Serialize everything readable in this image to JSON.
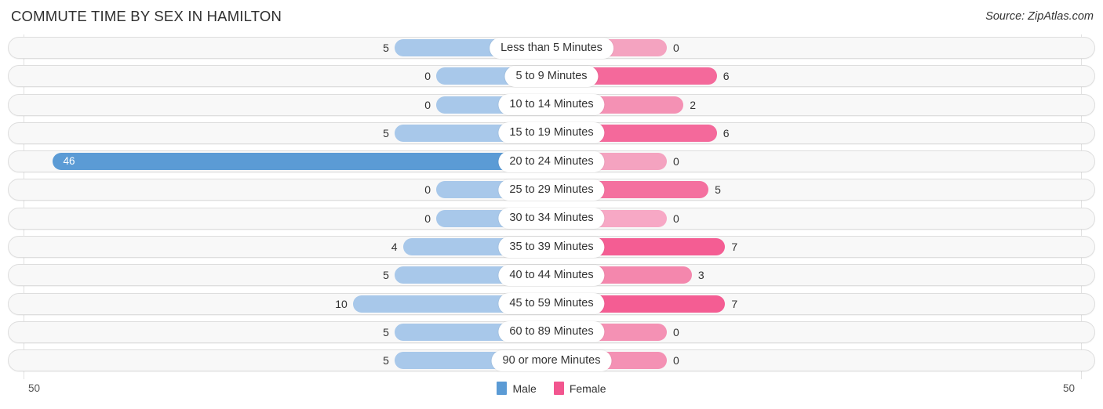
{
  "header": {
    "title": "COMMUTE TIME BY SEX IN HAMILTON",
    "source": "Source: ZipAtlas.com"
  },
  "axis": {
    "left_label": "50",
    "right_label": "50"
  },
  "legend": {
    "items": [
      {
        "label": "Male",
        "color": "#5b9bd5"
      },
      {
        "label": "Female",
        "color": "#f2568f"
      }
    ]
  },
  "chart_data": {
    "type": "bar",
    "title": "COMMUTE TIME BY SEX IN HAMILTON",
    "subtitle": "Source: ZipAtlas.com",
    "orientation": "horizontal-diverging",
    "xlabel": "",
    "ylabel": "",
    "xlim": [
      -50,
      50
    ],
    "axis_max": 50,
    "grid": true,
    "legend_position": "bottom-center",
    "categories": [
      "Less than 5 Minutes",
      "5 to 9 Minutes",
      "10 to 14 Minutes",
      "15 to 19 Minutes",
      "20 to 24 Minutes",
      "25 to 29 Minutes",
      "30 to 34 Minutes",
      "35 to 39 Minutes",
      "40 to 44 Minutes",
      "45 to 59 Minutes",
      "60 to 89 Minutes",
      "90 or more Minutes"
    ],
    "series": [
      {
        "name": "Male",
        "color": "#5b9bd5",
        "values": [
          5,
          0,
          0,
          5,
          46,
          0,
          0,
          4,
          5,
          10,
          5,
          5
        ]
      },
      {
        "name": "Female",
        "color": "#f2568f",
        "values": [
          0,
          6,
          2,
          6,
          0,
          5,
          0,
          7,
          3,
          7,
          0,
          0
        ]
      }
    ],
    "rows": [
      {
        "label": "Less than 5 Minutes",
        "male": 5,
        "male_text": "5",
        "female": 0,
        "female_text": "0",
        "male_color": "#a8c8ea",
        "female_color": "#f4a3c0",
        "male_highlight": false,
        "male_label_inside": false
      },
      {
        "label": "5 to 9 Minutes",
        "male": 0,
        "male_text": "0",
        "female": 6,
        "female_text": "6",
        "male_color": "#a8c8ea",
        "female_color": "#f4699b",
        "male_highlight": false,
        "male_label_inside": false
      },
      {
        "label": "10 to 14 Minutes",
        "male": 0,
        "male_text": "0",
        "female": 2,
        "female_text": "2",
        "male_color": "#a8c8ea",
        "female_color": "#f491b4",
        "male_highlight": false,
        "male_label_inside": false
      },
      {
        "label": "15 to 19 Minutes",
        "male": 5,
        "male_text": "5",
        "female": 6,
        "female_text": "6",
        "male_color": "#a8c8ea",
        "female_color": "#f4699b",
        "male_highlight": false,
        "male_label_inside": false
      },
      {
        "label": "20 to 24 Minutes",
        "male": 46,
        "male_text": "46",
        "female": 0,
        "female_text": "0",
        "male_color": "#5b9bd5",
        "female_color": "#f4a3c0",
        "male_highlight": true,
        "male_label_inside": true
      },
      {
        "label": "25 to 29 Minutes",
        "male": 0,
        "male_text": "0",
        "female": 5,
        "female_text": "5",
        "male_color": "#a8c8ea",
        "female_color": "#f4709f",
        "male_highlight": false,
        "male_label_inside": false
      },
      {
        "label": "30 to 34 Minutes",
        "male": 0,
        "male_text": "0",
        "female": 0,
        "female_text": "0",
        "male_color": "#a8c8ea",
        "female_color": "#f7a8c5",
        "male_highlight": false,
        "male_label_inside": false
      },
      {
        "label": "35 to 39 Minutes",
        "male": 4,
        "male_text": "4",
        "female": 7,
        "female_text": "7",
        "male_color": "#a8c8ea",
        "female_color": "#f45d93",
        "male_highlight": false,
        "male_label_inside": false
      },
      {
        "label": "40 to 44 Minutes",
        "male": 5,
        "male_text": "5",
        "female": 3,
        "female_text": "3",
        "male_color": "#a8c8ea",
        "female_color": "#f487ad",
        "male_highlight": false,
        "male_label_inside": false
      },
      {
        "label": "45 to 59 Minutes",
        "male": 10,
        "male_text": "10",
        "female": 7,
        "female_text": "7",
        "male_color": "#a8c8ea",
        "female_color": "#f45d93",
        "male_highlight": false,
        "male_label_inside": false
      },
      {
        "label": "60 to 89 Minutes",
        "male": 5,
        "male_text": "5",
        "female": 0,
        "female_text": "0",
        "male_color": "#a8c8ea",
        "female_color": "#f491b4",
        "male_highlight": false,
        "male_label_inside": false
      },
      {
        "label": "90 or more Minutes",
        "male": 5,
        "male_text": "5",
        "female": 0,
        "female_text": "0",
        "male_color": "#a8c8ea",
        "female_color": "#f491b4",
        "male_highlight": false,
        "male_label_inside": false
      }
    ]
  }
}
